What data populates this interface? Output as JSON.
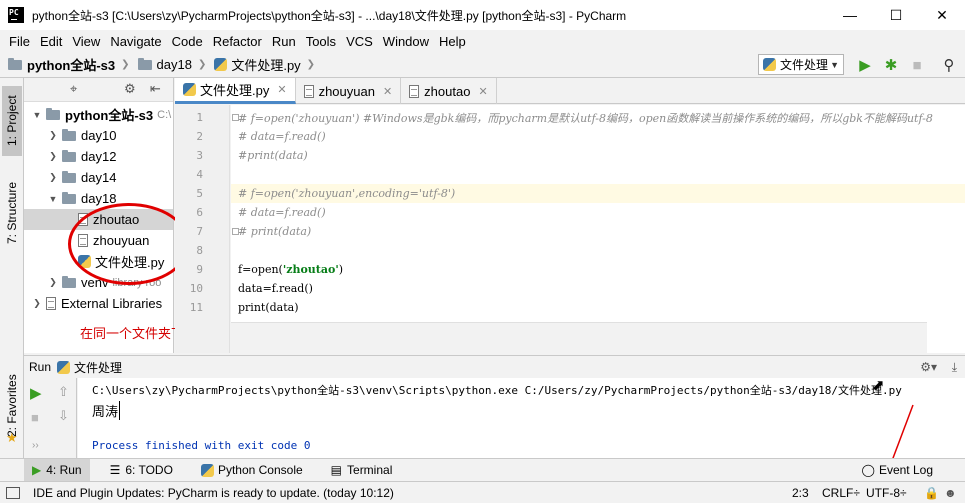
{
  "window": {
    "title": "python全站-s3 [C:\\Users\\zy\\PycharmProjects\\python全站-s3] - ...\\day18\\文件处理.py [python全站-s3] - PyCharm",
    "app_icon_text": "PC"
  },
  "menu": [
    "File",
    "Edit",
    "View",
    "Navigate",
    "Code",
    "Refactor",
    "Run",
    "Tools",
    "VCS",
    "Window",
    "Help"
  ],
  "breadcrumb": [
    "python全站-s3",
    "day18",
    "文件处理.py"
  ],
  "run_config": "文件处理",
  "side_tabs": {
    "project": "1: Project",
    "structure": "7: Structure",
    "favorites": "2: Favorites"
  },
  "project_tree": [
    {
      "label": "python全站-s3",
      "suffix": "C:\\",
      "kind": "folder",
      "level": 0,
      "open": true,
      "bold": true
    },
    {
      "label": "day10",
      "kind": "folder",
      "level": 1,
      "open": false
    },
    {
      "label": "day12",
      "kind": "folder",
      "level": 1,
      "open": false
    },
    {
      "label": "day14",
      "kind": "folder",
      "level": 1,
      "open": false
    },
    {
      "label": "day18",
      "kind": "folder",
      "level": 1,
      "open": true
    },
    {
      "label": "zhoutao",
      "kind": "file",
      "level": 2,
      "selected": true
    },
    {
      "label": "zhouyuan",
      "kind": "file",
      "level": 2
    },
    {
      "label": "文件处理.py",
      "kind": "py",
      "level": 2
    },
    {
      "label": "venv",
      "suffix": "library roo",
      "kind": "folder",
      "level": 1,
      "open": false
    },
    {
      "label": "External Libraries",
      "kind": "lib",
      "level": 0,
      "open": false
    }
  ],
  "annotation": {
    "text": "在同一个文件夹下",
    "color": "#e00000"
  },
  "editor_tabs": [
    {
      "label": "文件处理.py",
      "kind": "py",
      "active": true
    },
    {
      "label": "zhouyuan",
      "kind": "file"
    },
    {
      "label": "zhoutao",
      "kind": "file"
    }
  ],
  "code_lines": [
    {
      "n": "1",
      "parts": [
        {
          "t": "# f=open('zhouyuan') #Windows是gbk编码，而pycharm是默认utf-8编码，open函数解读当前操作系统的编码，所以gbk不能解码utf-8",
          "c": "cmt"
        }
      ]
    },
    {
      "n": "2",
      "parts": [
        {
          "t": "# data=f.read()",
          "c": "cmt"
        }
      ]
    },
    {
      "n": "3",
      "parts": [
        {
          "t": "#print(data)",
          "c": "cmt"
        }
      ]
    },
    {
      "n": "4",
      "parts": []
    },
    {
      "n": "5",
      "hl": true,
      "parts": [
        {
          "t": "# f=open('zhouyuan',encoding='utf-8')",
          "c": "cmt"
        }
      ]
    },
    {
      "n": "6",
      "parts": [
        {
          "t": "# data=f.read()",
          "c": "cmt"
        }
      ]
    },
    {
      "n": "7",
      "parts": [
        {
          "t": "# print(data)",
          "c": "cmt"
        }
      ]
    },
    {
      "n": "8",
      "parts": []
    },
    {
      "n": "9",
      "parts": [
        {
          "t": "f=open(",
          "c": ""
        },
        {
          "t": "'zhoutao'",
          "c": "str"
        },
        {
          "t": ")",
          "c": ""
        }
      ]
    },
    {
      "n": "10",
      "parts": [
        {
          "t": "data=f.read()",
          "c": ""
        }
      ]
    },
    {
      "n": "11",
      "parts": [
        {
          "t": "print(data)",
          "c": ""
        }
      ]
    }
  ],
  "run_panel": {
    "label": "Run",
    "config": "文件处理",
    "console": [
      "C:\\Users\\zy\\PycharmProjects\\python全站-s3\\venv\\Scripts\\python.exe C:/Users/zy/PycharmProjects/python全站-s3/day18/文件处理.py",
      "周涛",
      "",
      "Process finished with exit code 0"
    ]
  },
  "tool_windows": [
    {
      "label": "4: Run",
      "icon": "play-icon",
      "active": true
    },
    {
      "label": "6: TODO",
      "icon": "todo-icon"
    },
    {
      "label": "Python Console",
      "icon": "python-icon"
    },
    {
      "label": "Terminal",
      "icon": "terminal-icon"
    }
  ],
  "event_log": "Event Log",
  "status": {
    "message": "IDE and Plugin Updates: PyCharm is ready to update. (today 10:12)",
    "position": "2:3",
    "line_sep": "CRLF÷",
    "encoding": "UTF-8÷"
  },
  "colors": {
    "accent": "#4a88c7",
    "run_green": "#3a9d23",
    "annotation_red": "#e00000",
    "comment": "#8c8c8c",
    "string": "#067d17"
  }
}
